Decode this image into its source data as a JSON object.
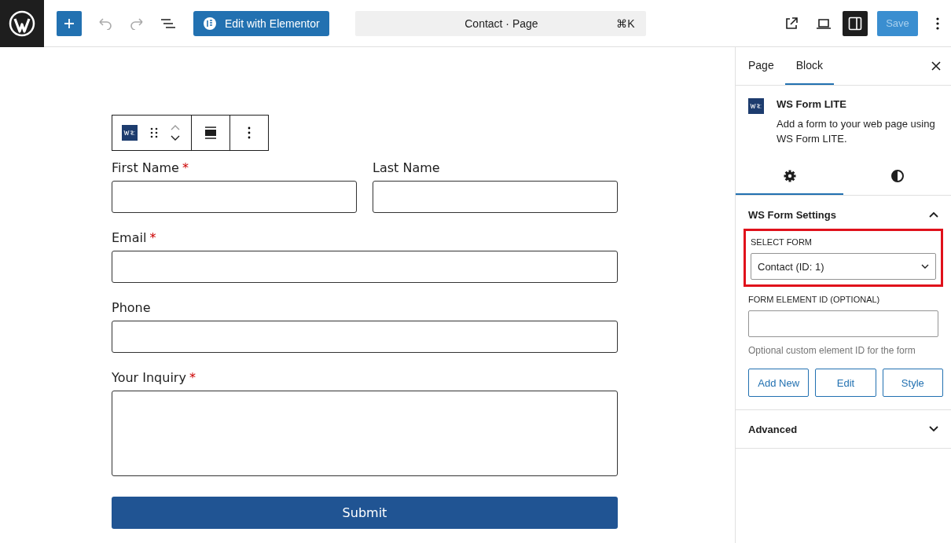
{
  "top_bar": {
    "elementor_button": "Edit with Elementor",
    "command": {
      "title": "Contact · Page",
      "shortcut": "⌘K"
    },
    "sidebar_toggle_on": true,
    "save": {
      "label": "Save",
      "disabled": true
    }
  },
  "document": {
    "rows": [
      [
        {
          "label": "First Name",
          "required_mark": "*",
          "kind": "input"
        },
        {
          "label": "Last Name",
          "kind": "input"
        }
      ],
      [
        {
          "label": "Email",
          "required_mark": "*",
          "kind": "input"
        }
      ],
      [
        {
          "label": "Phone",
          "kind": "input"
        }
      ],
      [
        {
          "label": "Your Inquiry",
          "required_mark": "*",
          "kind": "textarea"
        }
      ]
    ],
    "submit": "Submit"
  },
  "sidebar": {
    "tabs": [
      {
        "label": "Page",
        "selected": false
      },
      {
        "label": "Block",
        "selected": true
      }
    ],
    "block": {
      "name": "WS Form LITE",
      "description": "Add a form to your web page using WS Form LITE."
    },
    "style_tabs": [
      {
        "kind": "settings",
        "selected": true
      },
      {
        "kind": "styles",
        "selected": false
      }
    ],
    "settings_panel": {
      "title": "WS Form Settings",
      "expanded": true,
      "select_form": {
        "label": "SELECT FORM",
        "value": "Contact (ID: 1)",
        "highlighted": true
      },
      "element_id": {
        "label": "FORM ELEMENT ID (OPTIONAL)",
        "help": "Optional custom element ID for the form"
      },
      "buttons": [
        "Add New",
        "Edit",
        "Style"
      ]
    },
    "advanced_panel": {
      "title": "Advanced",
      "expanded": false
    }
  }
}
